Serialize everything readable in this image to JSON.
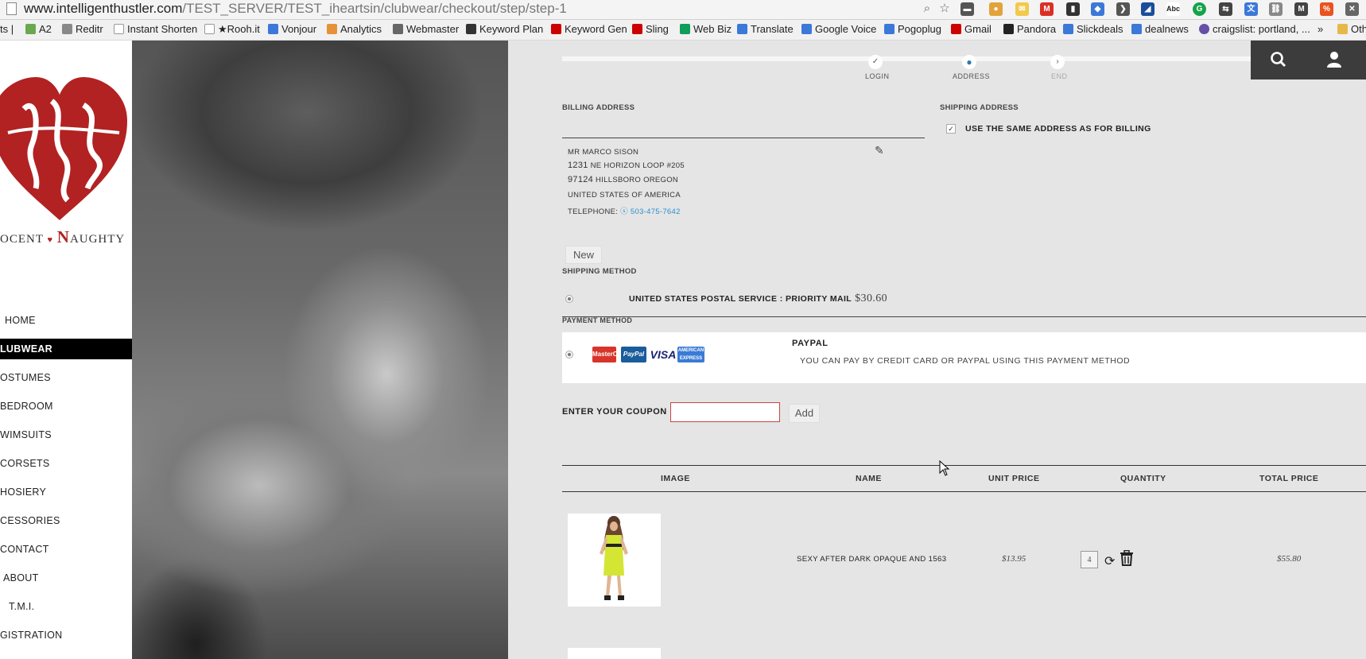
{
  "browser": {
    "url_host": "www.intelligenthustler.com",
    "url_path": "/TEST_SERVER/TEST_iheartsin/clubwear/checkout/step/step-1",
    "bookmarks": [
      "ts |",
      "A2",
      "Reditr",
      "Instant Shorten",
      "★Rooh.it",
      "Vonjour",
      "Analytics",
      "Webmaster",
      "Keyword Plan",
      "Keyword Gen",
      "Sling",
      "Web Biz",
      "Translate",
      "Google Voice",
      "Pogoplug",
      "Gmail",
      "Pandora",
      "Slickdeals",
      "dealnews",
      "craigslist: portland, ...",
      "»",
      "Oth"
    ],
    "bookmark_colors": [
      "#999999",
      "#6aa84f",
      "#888888",
      "#ffffff",
      "#888888",
      "#3c78d8",
      "#e69138",
      "#666666",
      "#333333",
      "#cc0000",
      "#cc0000",
      "#0f9d58",
      "#3c78d8",
      "#3c78d8",
      "#3c78d8",
      "#cc0000",
      "#222222",
      "#3c78d8",
      "#3c78d8",
      "#674ea7",
      "#ffffff",
      "#e6b84a"
    ]
  },
  "sidebar": {
    "logo_text_a": "OCENT",
    "logo_heart": "♥",
    "logo_text_b": "N",
    "logo_text_c": "AUGHTY",
    "nav": [
      "HOME",
      "LUBWEAR",
      "OSTUMES",
      "BEDROOM",
      "WIMSUITS",
      "CORSETS",
      "HOSIERY",
      "CESSORIES",
      "CONTACT",
      "ABOUT",
      "T.M.I.",
      "GISTRATION"
    ]
  },
  "steps": {
    "items": [
      "LOGIN",
      "ADDRESS",
      "END"
    ],
    "active": "ADDRESS"
  },
  "billing": {
    "title": "BILLING ADDRESS",
    "name": "MR MARCO SISON",
    "street_num": "1231",
    "street": "NE HORIZON LOOP #205",
    "zip": "97124",
    "city": "HILLSBORO OREGON",
    "country": "UNITED STATES OF AMERICA",
    "phone_label": "TELEPHONE:",
    "phone": "503-475-7642",
    "new_button": "New"
  },
  "shipping_address": {
    "title": "SHIPPING ADDRESS",
    "same_label": "USE THE SAME ADDRESS AS FOR BILLING",
    "same_checked": true
  },
  "shipping_method": {
    "title": "SHIPPING METHOD",
    "option": "UNITED STATES POSTAL SERVICE : PRIORITY MAIL",
    "price": "$30.60"
  },
  "payment_method": {
    "title": "PAYMENT METHOD",
    "cards": [
      "MasterCard",
      "PayPal",
      "VISA",
      "AMERICAN EXPRESS"
    ],
    "option_title": "PAYPAL",
    "option_desc": "YOU CAN PAY BY CREDIT CARD OR PAYPAL USING THIS PAYMENT METHOD"
  },
  "coupon": {
    "label": "ENTER YOUR COUPON",
    "value": "",
    "add_button": "Add"
  },
  "cart": {
    "columns": [
      "IMAGE",
      "NAME",
      "UNIT PRICE",
      "QUANTITY",
      "TOTAL PRICE"
    ],
    "items": [
      {
        "name": "SEXY AFTER DARK OPAQUE AND 1563",
        "unit_price": "$13.95",
        "quantity": "4",
        "total_price": "$55.80"
      }
    ]
  },
  "colors": {
    "accent": "#b22222",
    "sidebar_active": "#000000",
    "topbar": "#3c3c3c",
    "phone_link": "#2a8fd0"
  }
}
